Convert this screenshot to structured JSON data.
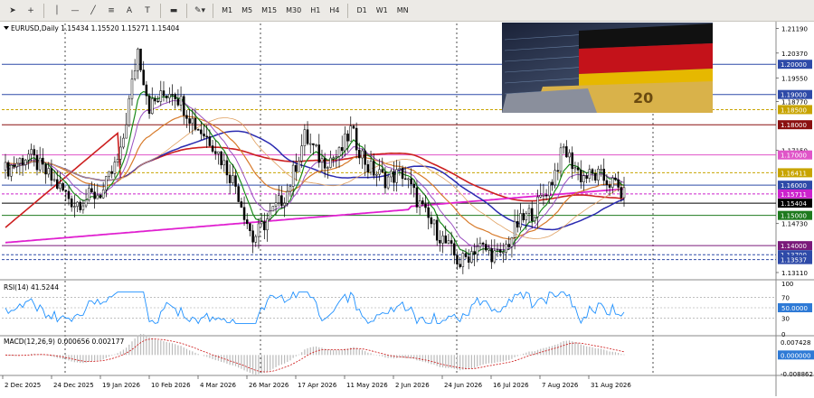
{
  "toolbar": {
    "tools": [
      {
        "name": "cursor-icon",
        "glyph": "➤"
      },
      {
        "name": "crosshair-icon",
        "glyph": "+"
      },
      {
        "name": "vertical-line-icon",
        "glyph": "│"
      },
      {
        "name": "horizontal-line-icon",
        "glyph": "—"
      },
      {
        "name": "trendline-icon",
        "glyph": "╱"
      },
      {
        "name": "fibonacci-icon",
        "glyph": "≡"
      },
      {
        "name": "text-icon",
        "glyph": "A"
      },
      {
        "name": "text-label-icon",
        "glyph": "T"
      },
      {
        "name": "rectangle-icon",
        "glyph": "▬"
      },
      {
        "name": "shapes-icon",
        "glyph": "✎▾"
      }
    ],
    "timeframes": [
      "M1",
      "M5",
      "M15",
      "M30",
      "H1",
      "H4",
      "D1",
      "W1",
      "MN"
    ]
  },
  "chart": {
    "header": "EURUSD,Daily  1.15434 1.15520 1.15271 1.15404",
    "rsi_label": "RSI(14) 41.5244",
    "macd_label": "MACD(12,26,9) 0.000656 0.002177",
    "dates": [
      "2 Dec 2025",
      "24 Dec 2025",
      "19 Jan 2026",
      "10 Feb 2026",
      "4 Mar 2026",
      "26 Mar 2026",
      "17 Apr 2026",
      "11 May 2026",
      "2 Jun 2026",
      "24 Jun 2026",
      "16 Jul 2026",
      "7 Aug 2026",
      "31 Aug 2026"
    ],
    "price_axis": [
      {
        "text": "1.21190",
        "price": 1.2119
      },
      {
        "text": "1.20370",
        "price": 1.2037
      },
      {
        "text": "1.19550",
        "price": 1.1955
      },
      {
        "text": "1.18770",
        "price": 1.1877
      },
      {
        "text": "1.17150",
        "price": 1.1715
      },
      {
        "text": "1.14730",
        "price": 1.1473
      },
      {
        "text": "1.13110",
        "price": 1.1311
      }
    ],
    "levels": [
      {
        "price": 1.2,
        "text": "1.20000",
        "color": "#2e4aa8",
        "dash": false,
        "tag": true
      },
      {
        "price": 1.19,
        "text": "1.19000",
        "color": "#2e4aa8",
        "dash": false,
        "tag": true
      },
      {
        "price": 1.185,
        "text": "1.18500",
        "color": "#c8a400",
        "dash": true,
        "tag": true
      },
      {
        "price": 1.18,
        "text": "1.18000",
        "color": "#8b1010",
        "dash": false,
        "tag": true
      },
      {
        "price": 1.17,
        "text": "1.17000",
        "color": "#e055c8",
        "dash": false,
        "tag": true
      },
      {
        "price": 1.16411,
        "text": "1.16411",
        "color": "#c8a400",
        "dash": true,
        "tag": true
      },
      {
        "price": 1.16,
        "text": "1.16000",
        "color": "#2e4aa8",
        "dash": false,
        "tag": true
      },
      {
        "price": 1.15711,
        "text": "1.15711",
        "color": "#cc22cc",
        "dash": true,
        "tag": true
      },
      {
        "price": 1.15404,
        "text": "1.15404",
        "color": "#000000",
        "dash": false,
        "tag": true
      },
      {
        "price": 1.15,
        "text": "1.15000",
        "color": "#1e7a1e",
        "dash": false,
        "tag": true
      },
      {
        "price": 1.14,
        "text": "1.14000",
        "color": "#7a1a7a",
        "dash": false,
        "tag": true
      },
      {
        "price": 1.137,
        "text": "1.13700",
        "color": "#2e4aa8",
        "dash": true,
        "tag": true
      },
      {
        "price": 1.13537,
        "text": "1.13537",
        "color": "#2e4aa8",
        "dash": true,
        "tag": true
      }
    ],
    "rsi_axis": [
      "100",
      "70",
      "50.0000",
      "30",
      "0"
    ],
    "macd_axis": [
      "0.007428",
      "0.000000",
      "-0.008862"
    ],
    "colors": {
      "up_candle": "#000000",
      "down_candle": "#000000",
      "ma_red": "#cc1f1f",
      "ma_magenta": "#e020d0",
      "ma_navy": "#2a2ab0",
      "ma_orange": "#d77a2a",
      "ma_green": "#1a8a1a",
      "ma_purple": "#9a50c0",
      "ma_tan": "#e0a060",
      "rsi_line": "#1e90ff",
      "macd_hist": "#bbbbbb",
      "macd_signal": "#cc1111"
    }
  }
}
